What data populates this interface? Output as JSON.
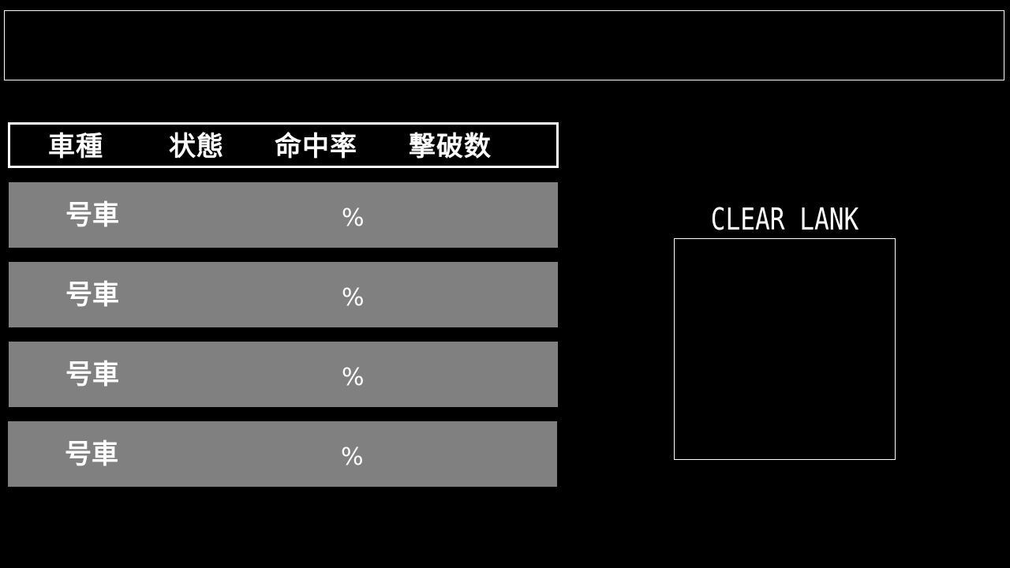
{
  "header": {
    "columns": [
      "車種",
      "状態",
      "命中率",
      "撃破数"
    ]
  },
  "rows": [
    {
      "vehicle_label": "号車",
      "percent_label": "%"
    },
    {
      "vehicle_label": "号車",
      "percent_label": "%"
    },
    {
      "vehicle_label": "号車",
      "percent_label": "%"
    },
    {
      "vehicle_label": "号車",
      "percent_label": "%"
    }
  ],
  "clear_rank": {
    "label": "CLEAR LANK"
  },
  "colors": {
    "background": "#000000",
    "row_fill": "#808080",
    "text": "#ffffff",
    "border": "#ffffff"
  }
}
